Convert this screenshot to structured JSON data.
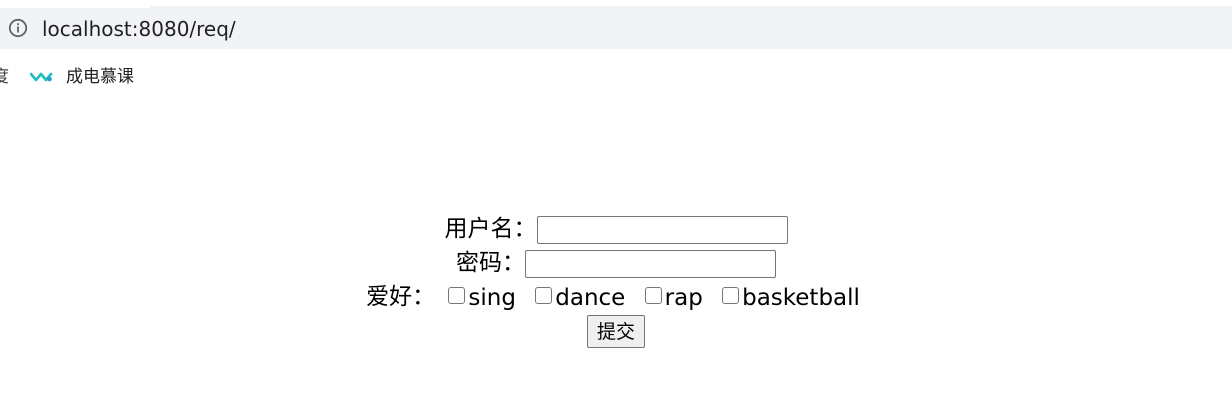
{
  "browser": {
    "url": "localhost:8080/req/",
    "info_icon": "info-circle-icon"
  },
  "bookmarks": {
    "partial_label": "度",
    "items": [
      {
        "label": "成电慕课",
        "icon": "mooc-logo-icon",
        "icon_color": "#1fbfbf"
      }
    ]
  },
  "form": {
    "username_label": "用户名：",
    "username_value": "",
    "password_label": "密码：",
    "password_value": "",
    "hobby_label": "爱好：",
    "hobbies": [
      {
        "label": "sing",
        "checked": false
      },
      {
        "label": "dance",
        "checked": false
      },
      {
        "label": "rap",
        "checked": false
      },
      {
        "label": "basketball",
        "checked": false
      }
    ],
    "submit_label": "提交"
  }
}
